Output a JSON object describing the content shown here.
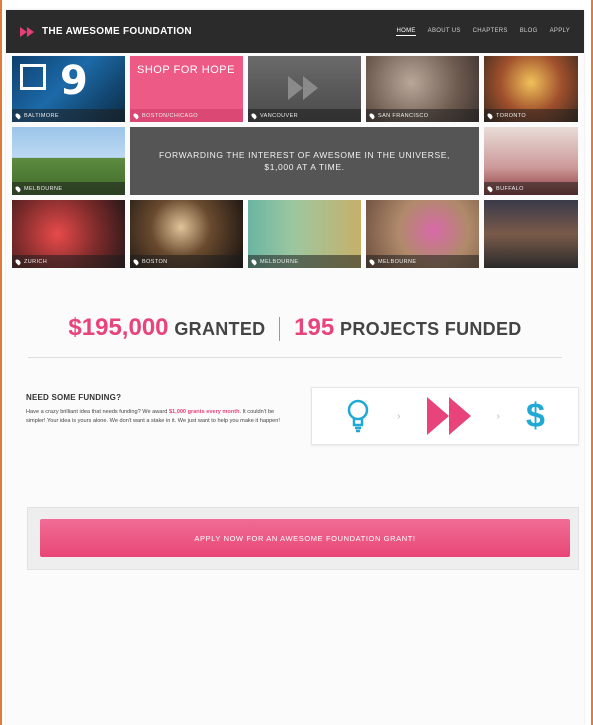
{
  "nav": {
    "logo_text": "THE AWESOME FOUNDATION",
    "items": [
      "HOME",
      "ABOUT US",
      "CHAPTERS",
      "BLOG",
      "APPLY"
    ]
  },
  "tiles": {
    "shop_title": "SHOP FOR HOPE",
    "banner": "FORWARDING THE INTEREST OF AWESOME IN THE UNIVERSE, $1,000 AT A TIME.",
    "locations": [
      "BALTIMORE",
      "BOSTON/CHICAGO",
      "VANCOUVER",
      "SAN FRANCISCO",
      "TORONTO",
      "MELBOURNE",
      "BUFFALO",
      "ZURICH",
      "BOSTON",
      "MELBOURNE",
      "MELBOURNE"
    ]
  },
  "stats": {
    "granted_amount": "$195,000",
    "granted_label": "GRANTED",
    "projects_count": "195",
    "projects_label": "PROJECTS FUNDED"
  },
  "funding": {
    "title": "NEED SOME FUNDING?",
    "text_before": "Have a crazy brilliant idea that needs funding? We award ",
    "text_highlight": "$1,000 grants every month",
    "text_after": ". It couldn't be simpler! Your idea is yours alone. We don't want a stake in it. We just want to help you make it happen!"
  },
  "cta": {
    "label": "APPLY NOW FOR AN AWESOME FOUNDATION GRANT!"
  },
  "colors": {
    "accent": "#e8437a",
    "blue": "#1fa9d4",
    "nav_bg": "#2b2b2b"
  }
}
